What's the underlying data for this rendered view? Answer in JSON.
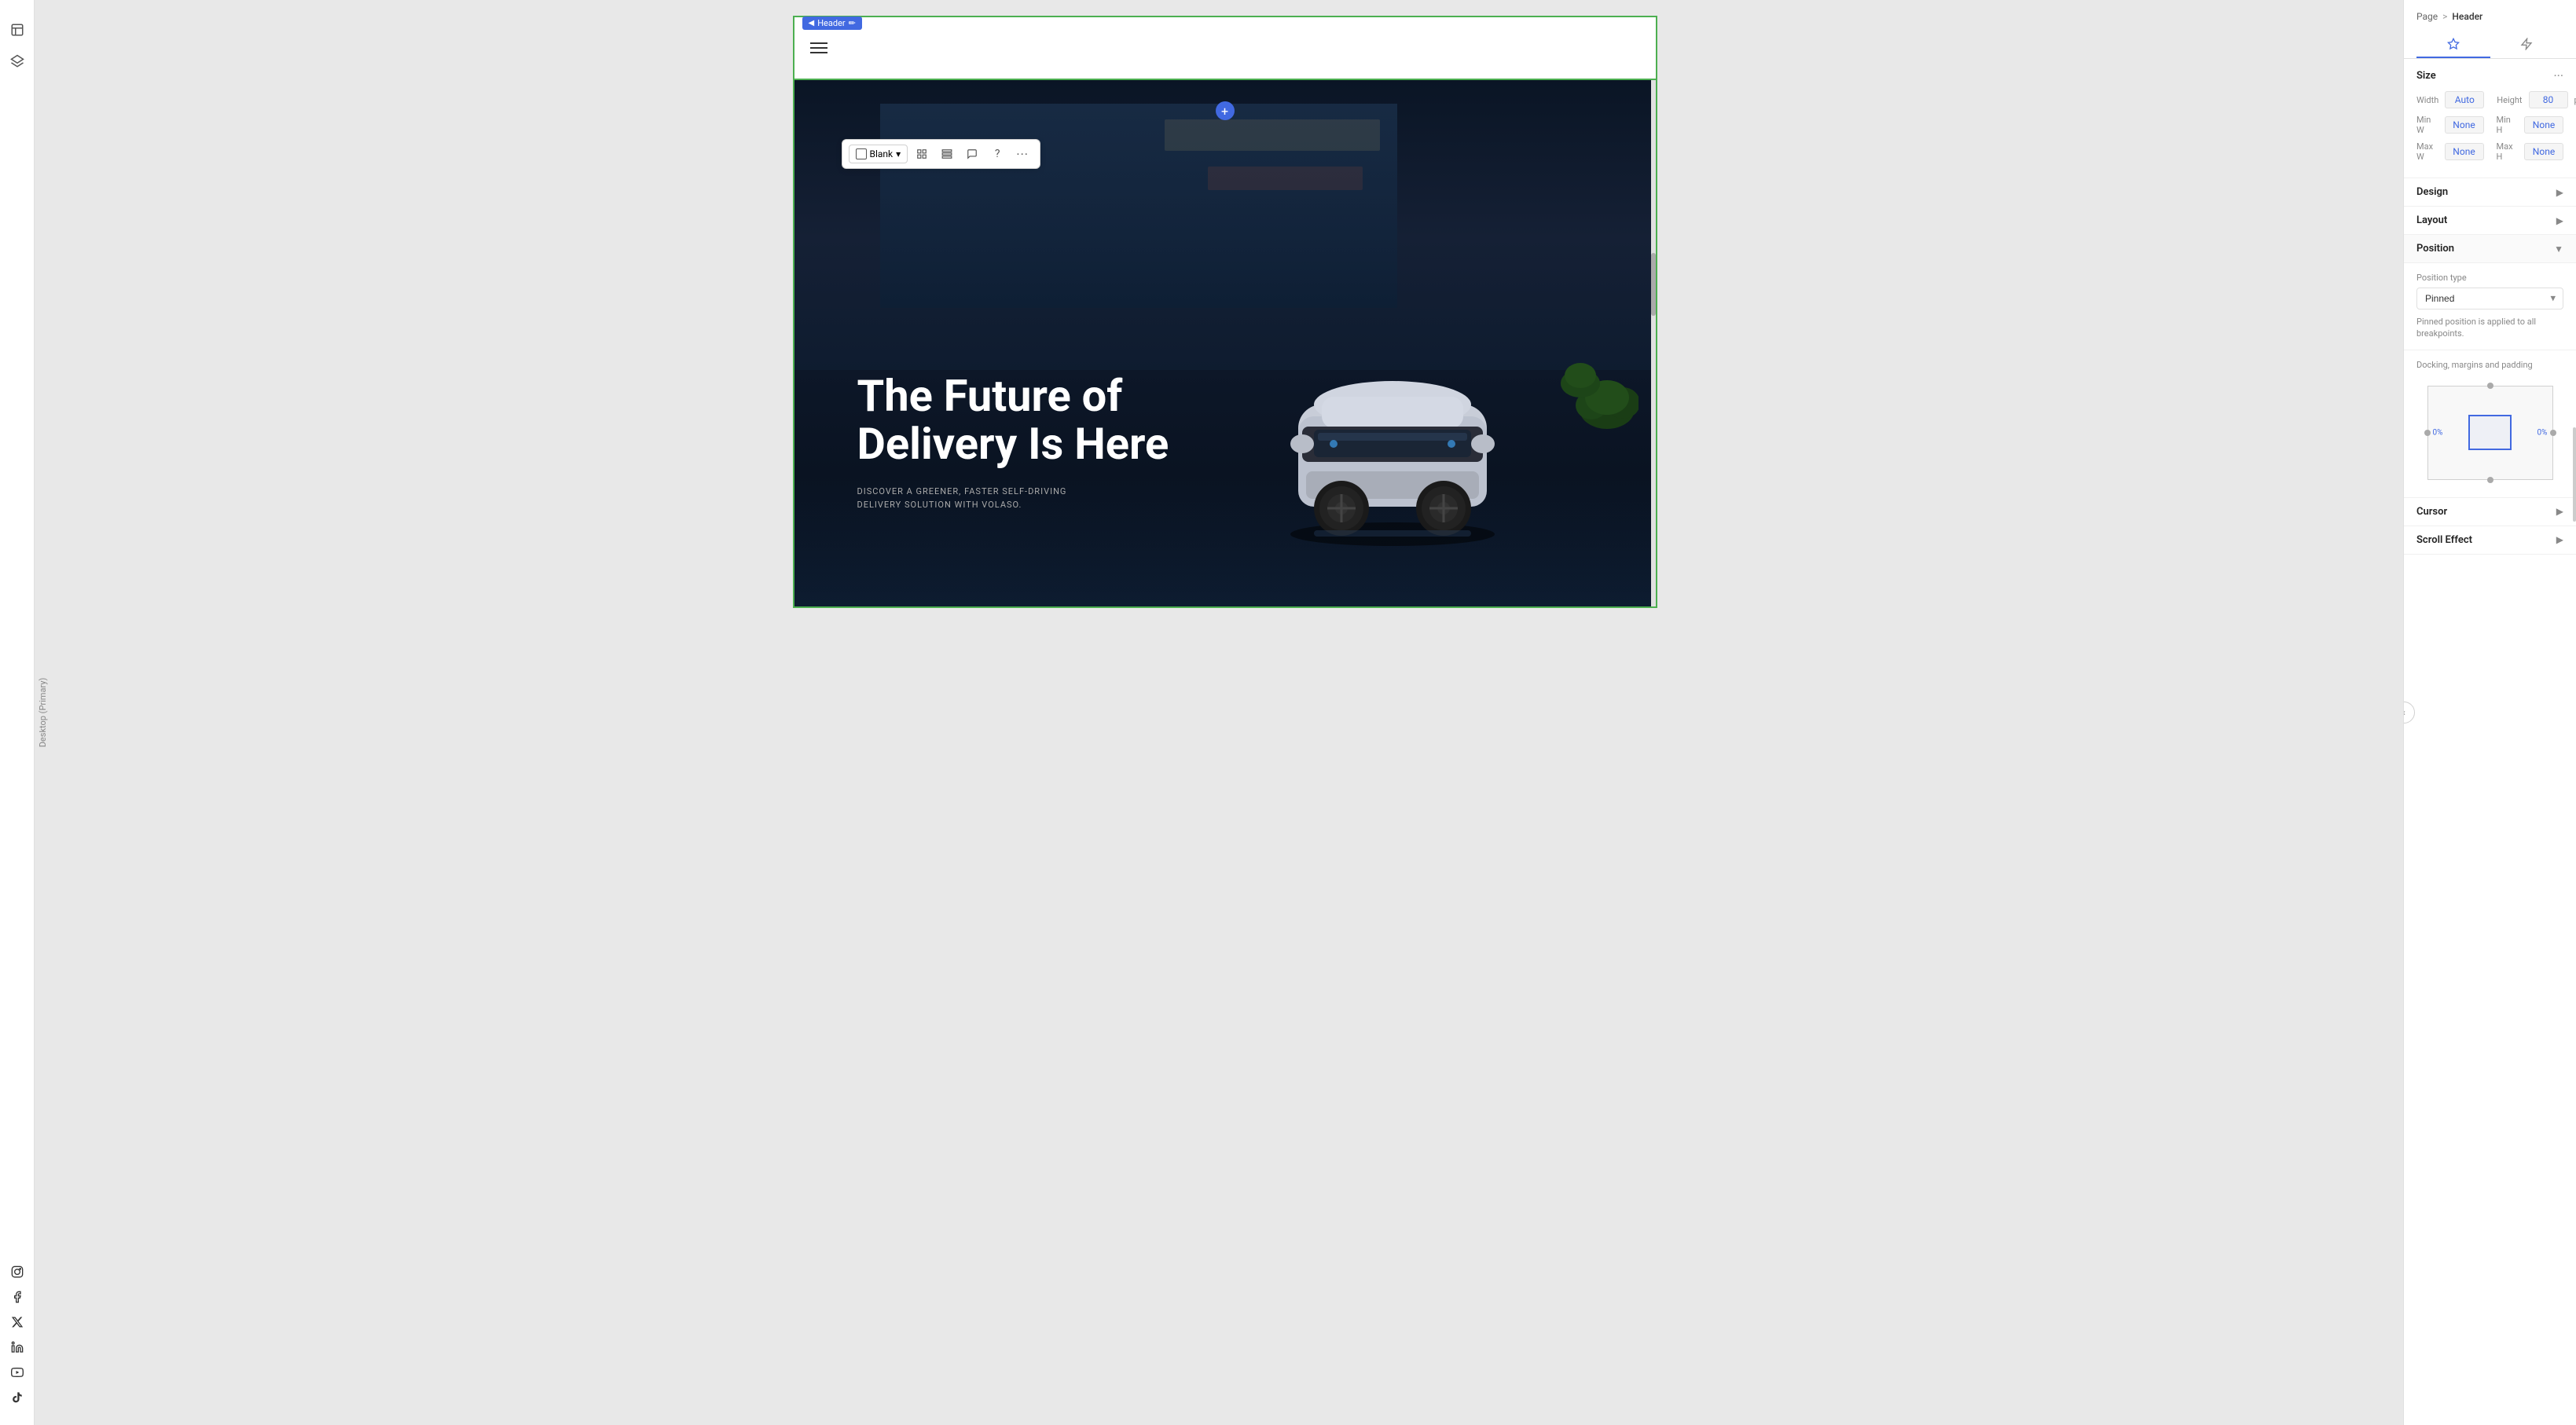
{
  "breadcrumb": {
    "parent": "Page",
    "separator": ">",
    "current": "Header"
  },
  "tabs": {
    "design": "design",
    "lightning": "lightning"
  },
  "size": {
    "label": "Size",
    "more_icon": "···",
    "width_label": "Width",
    "width_value": "Auto",
    "height_label": "Height",
    "height_value": "80",
    "height_unit": "px",
    "min_w_label": "Min W",
    "min_w_value": "None",
    "min_h_label": "Min H",
    "min_h_value": "None",
    "max_w_label": "Max W",
    "max_w_value": "None",
    "max_h_label": "Max H",
    "max_h_value": "None"
  },
  "sections": {
    "design": {
      "label": "Design",
      "arrow": "▶"
    },
    "layout": {
      "label": "Layout",
      "arrow": "▶"
    },
    "position": {
      "label": "Position",
      "arrow": "▼"
    }
  },
  "position": {
    "type_label": "Position type",
    "type_value": "Pinned",
    "note": "Pinned position is applied to all breakpoints."
  },
  "docking": {
    "label": "Docking, margins and padding",
    "left_value": "0%",
    "right_value": "0%"
  },
  "cursor": {
    "label": "Cursor",
    "arrow": "▶"
  },
  "scroll_effect": {
    "label": "Scroll Effect",
    "arrow": "▶"
  },
  "toolbar": {
    "blank_label": "Blank",
    "dropdown_arrow": "▾"
  },
  "header_badge": {
    "label": "Header",
    "edit_icon": "✏"
  },
  "hero": {
    "title_line1": "The Future of",
    "title_line2": "Delivery Is Here",
    "subtitle_line1": "DISCOVER A GREENER, FASTER SELF-DRIVING",
    "subtitle_line2": "DELIVERY SOLUTION WITH VOLASO."
  },
  "device_label": "Desktop (Primary)",
  "social_icons": [
    "instagram",
    "facebook",
    "twitter-x",
    "linkedin",
    "youtube",
    "tiktok"
  ],
  "colors": {
    "accent": "#4169E1",
    "green_border": "#4CAF50",
    "text_white": "#ffffff",
    "panel_bg": "#ffffff"
  }
}
